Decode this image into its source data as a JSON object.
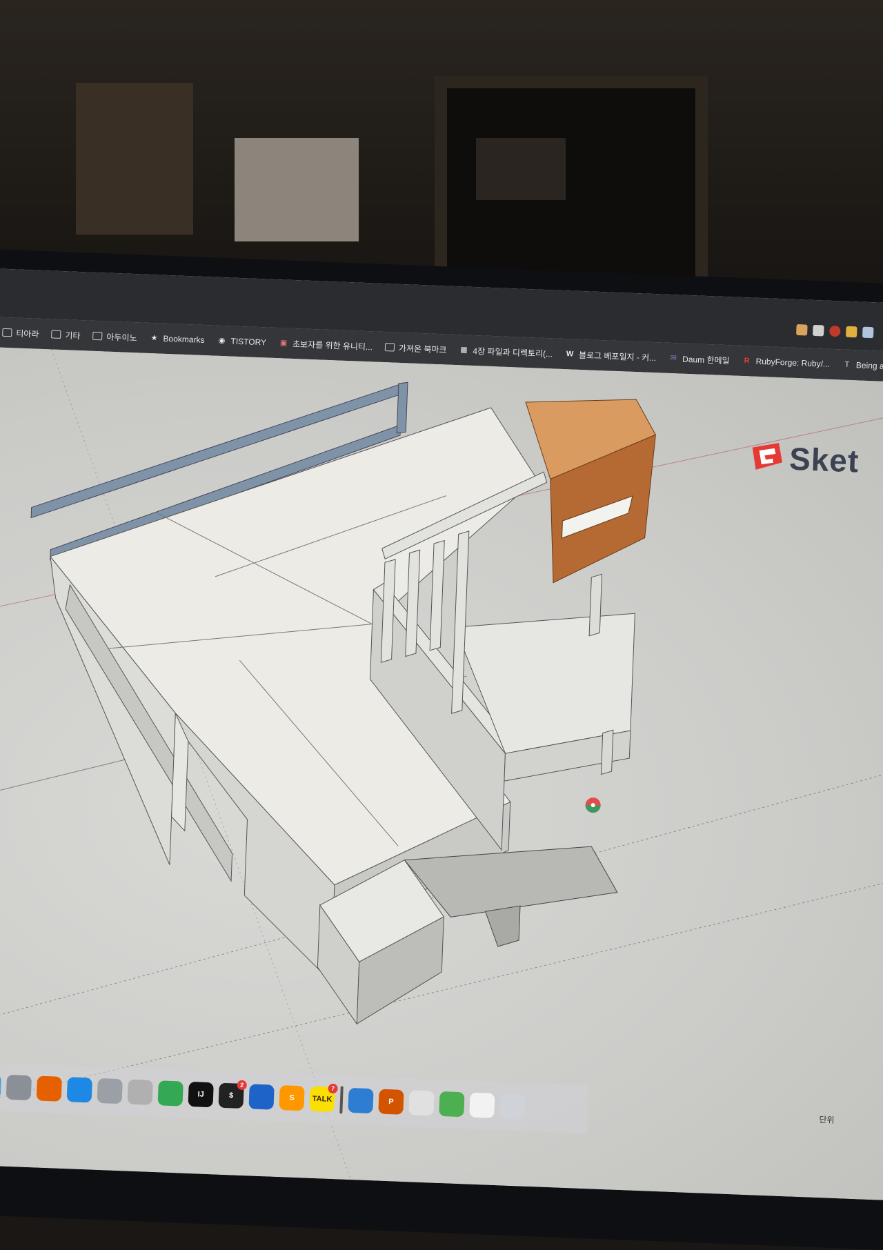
{
  "bookmarks": [
    {
      "label": "티아라",
      "icon": "folder-icon"
    },
    {
      "label": "기타",
      "icon": "folder-icon"
    },
    {
      "label": "아두이노",
      "icon": "folder-icon"
    },
    {
      "label": "Bookmarks",
      "icon": "star-icon"
    },
    {
      "label": "TISTORY",
      "icon": "globe-icon"
    },
    {
      "label": "초보자를 위한 유니티...",
      "icon": "site-icon"
    },
    {
      "label": "가져온 북마크",
      "icon": "folder-icon"
    },
    {
      "label": "4장 파일과 디렉토리(...",
      "icon": "site-icon"
    },
    {
      "label": "블로그 베포일지 - 커...",
      "icon": "w-icon"
    },
    {
      "label": "Daum 한메일",
      "icon": "mail-icon"
    },
    {
      "label": "RubyForge: Ruby/...",
      "icon": "rubyforge-icon"
    },
    {
      "label": "Being a Developer...",
      "icon": "site-icon"
    }
  ],
  "app": {
    "logo_text": "Sket",
    "unit_label": "단위"
  },
  "dock": [
    {
      "name": "finder",
      "color": "#4aa3df",
      "glyph": ""
    },
    {
      "name": "launchpad",
      "color": "#8a8f98",
      "glyph": ""
    },
    {
      "name": "firefox",
      "color": "#e66000",
      "glyph": ""
    },
    {
      "name": "safari",
      "color": "#1e88e5",
      "glyph": ""
    },
    {
      "name": "sequel",
      "color": "#9aa0a6",
      "glyph": ""
    },
    {
      "name": "database",
      "color": "#b0b0b0",
      "glyph": ""
    },
    {
      "name": "chrome",
      "color": "#34a853",
      "glyph": ""
    },
    {
      "name": "intellij",
      "color": "#111111",
      "glyph": "IJ"
    },
    {
      "name": "terminal",
      "color": "#222222",
      "glyph": "$",
      "badge": "2"
    },
    {
      "name": "sourcetree",
      "color": "#1e63c8",
      "glyph": ""
    },
    {
      "name": "sublime",
      "color": "#ff9800",
      "glyph": "S"
    },
    {
      "name": "kakaotalk",
      "color": "#f9e000",
      "glyph": "TALK",
      "badge": "7"
    },
    {
      "name": "divider",
      "color": "#555555",
      "glyph": ""
    },
    {
      "name": "xcode-blue",
      "color": "#2d7dd2",
      "glyph": ""
    },
    {
      "name": "powerpoint-like",
      "color": "#d35400",
      "glyph": "P"
    },
    {
      "name": "preview",
      "color": "#e0e0e0",
      "glyph": ""
    },
    {
      "name": "maps-like",
      "color": "#4caf50",
      "glyph": ""
    },
    {
      "name": "document",
      "color": "#f2f2f2",
      "glyph": ""
    },
    {
      "name": "trash",
      "color": "#cfd3d8",
      "glyph": ""
    }
  ]
}
